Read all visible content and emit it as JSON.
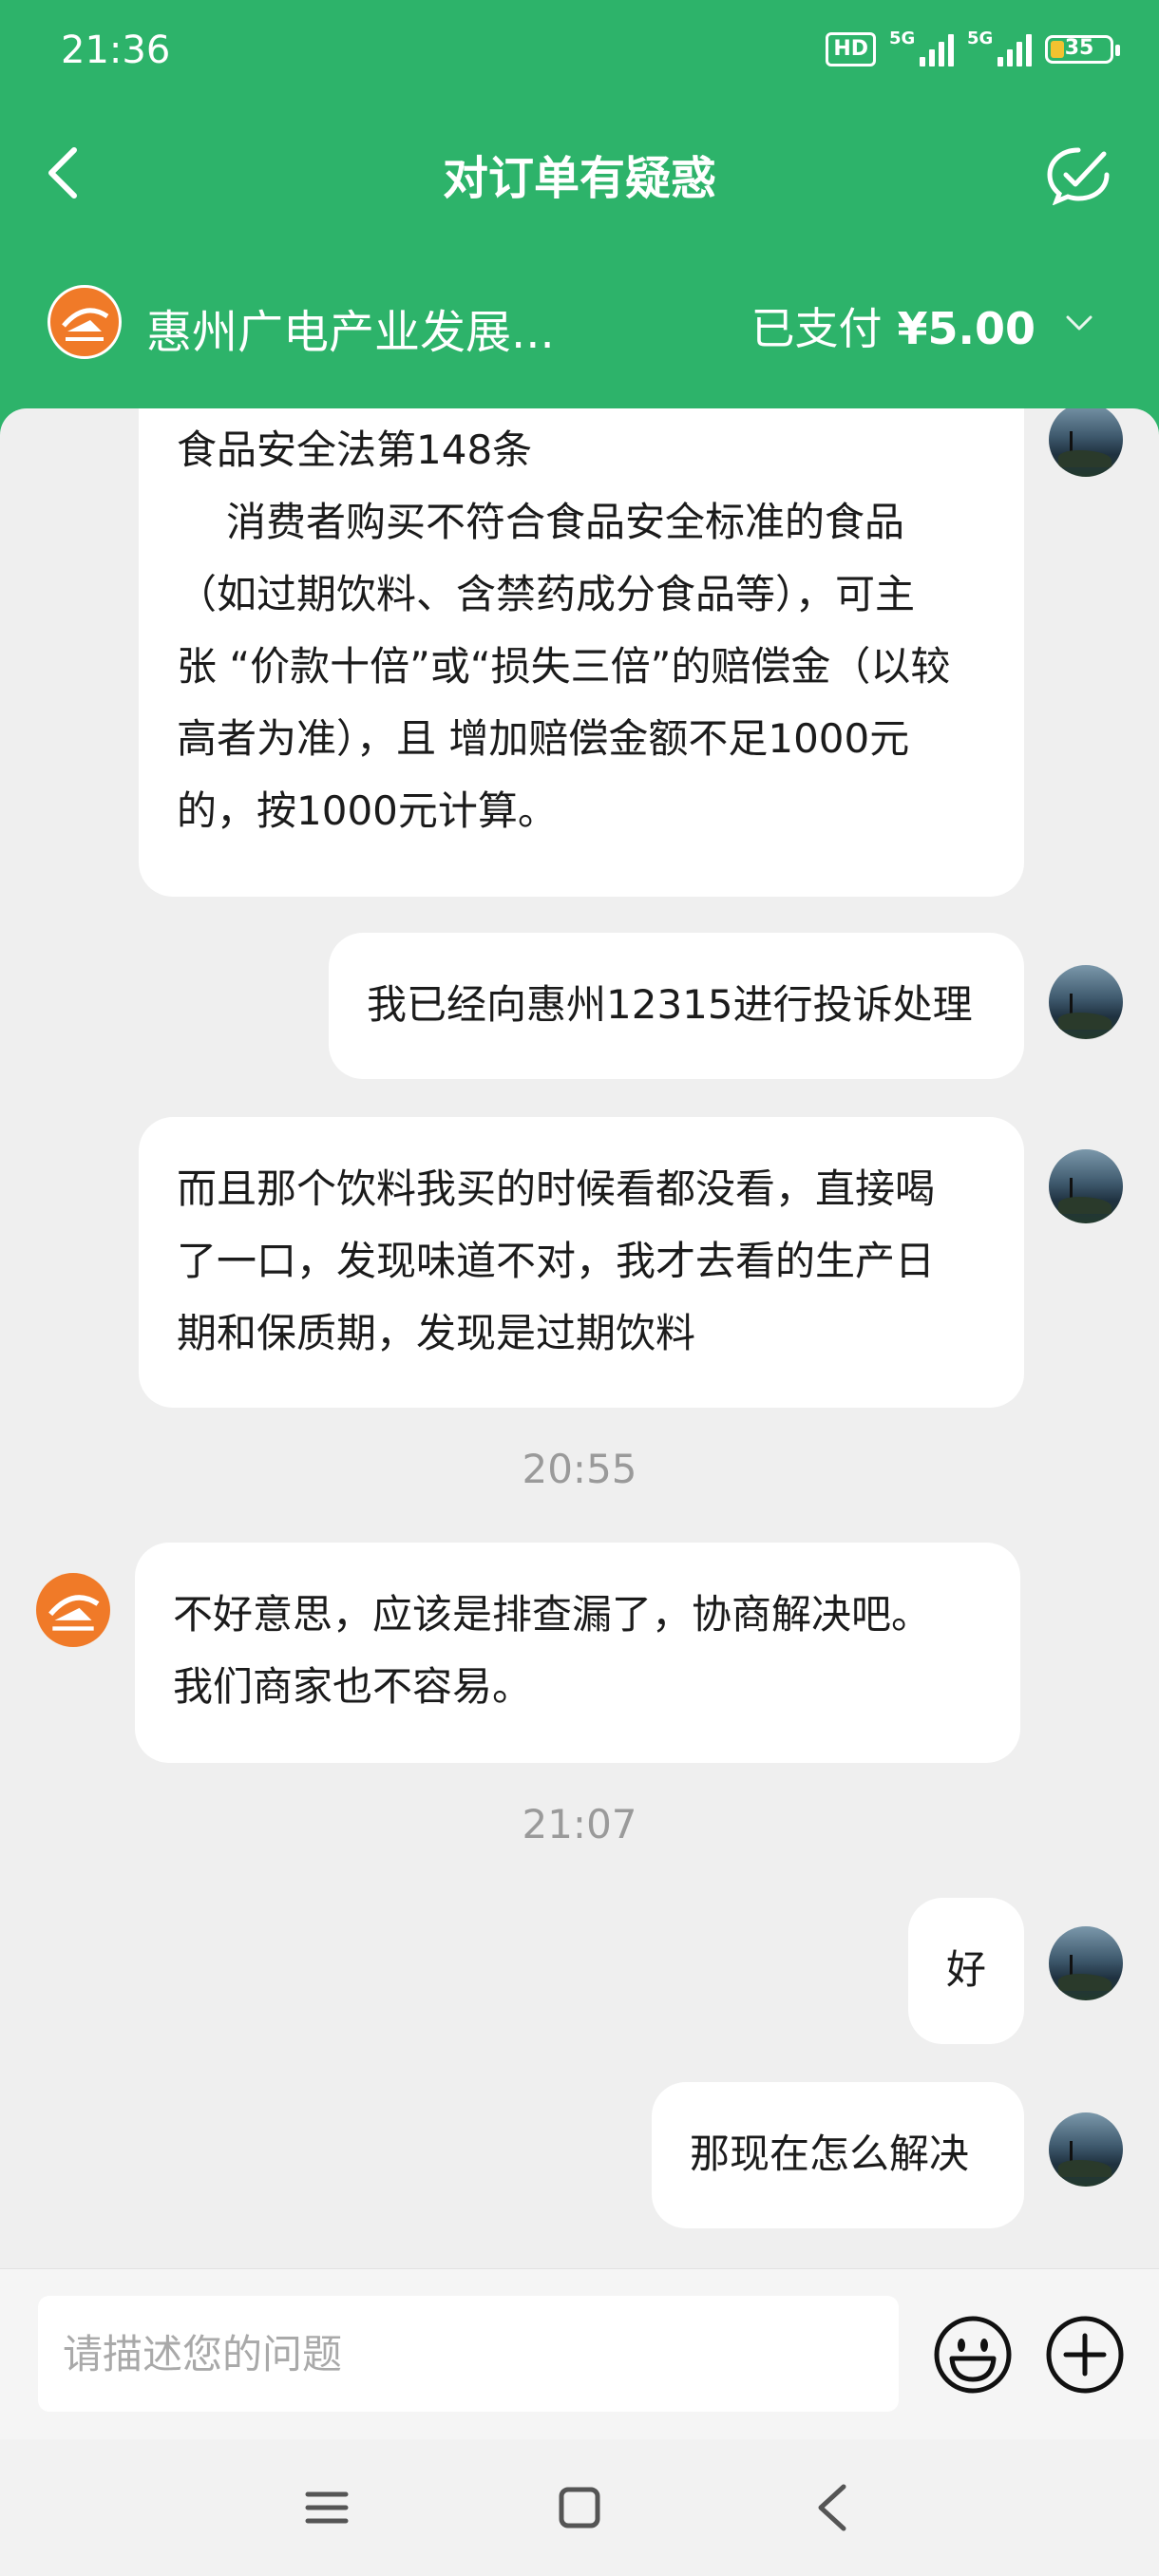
{
  "status_bar": {
    "time": "21:36",
    "hd": "HD",
    "signal1": "5G",
    "signal2": "5G",
    "battery": "35"
  },
  "header": {
    "title": "对订单有疑惑",
    "shop_name": "惠州广电产业发展...",
    "paid_label": "已支付",
    "paid_amount": "¥5.00"
  },
  "messages": {
    "m1_title": "食品安全法第148条",
    "m1_l1": "消费者购买不符合食品安全标准的食品",
    "m1_l2": "（如过期饮料、含禁药成分食品等），可主",
    "m1_l3": "张 “价款十倍”或“损失三倍”的赔偿金（以较",
    "m1_l4": "高者为准），且 增加赔偿金额不足1000元",
    "m1_l5": "的，按1000元计算。",
    "m2": "我已经向惠州12315进行投诉处理",
    "m3_l1": "而且那个饮料我买的时候看都没看，直接喝",
    "m3_l2": "了一口，发现味道不对，我才去看的生产日",
    "m3_l3": "期和保质期，发现是过期饮料",
    "time1": "20:55",
    "m4_l1": "不好意思，应该是排查漏了，协商解决吧。",
    "m4_l2": "我们商家也不容易。",
    "time2": "21:07",
    "m5": "好",
    "m6": "那现在怎么解决"
  },
  "input": {
    "placeholder": "请描述您的问题"
  },
  "colors": {
    "header_bg": "#2db36a",
    "shop_orange": "#f07a28"
  }
}
